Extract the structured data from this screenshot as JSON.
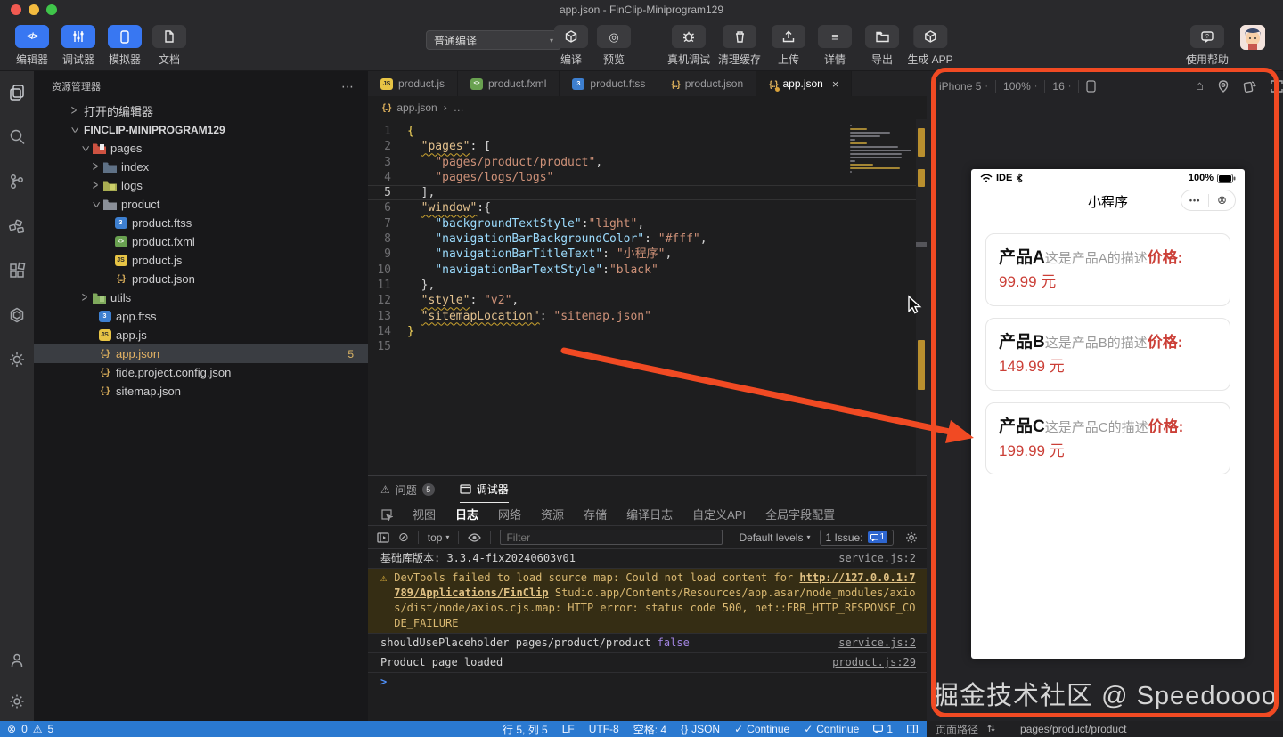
{
  "titlebar": {
    "title": "app.json - FinClip-Miniprogram129"
  },
  "toolbar": {
    "editor": "编辑器",
    "debugger": "调试器",
    "simulator": "模拟器",
    "docs": "文档",
    "compile_mode": "普通编译",
    "compile": "编译",
    "preview": "预览",
    "device_debug": "真机调试",
    "clear_cache": "清理缓存",
    "upload": "上传",
    "details": "详情",
    "export": "导出",
    "gen_app": "生成 APP",
    "help": "使用帮助"
  },
  "explorer": {
    "header": "资源管理器",
    "open_editors": "打开的编辑器",
    "root": "FINCLIP-MINIPROGRAM129",
    "items": {
      "pages": "pages",
      "index": "index",
      "logs": "logs",
      "product": "product",
      "product_ftss": "product.ftss",
      "product_fxml": "product.fxml",
      "product_js": "product.js",
      "product_json": "product.json",
      "utils": "utils",
      "app_ftss": "app.ftss",
      "app_js": "app.js",
      "app_json": "app.json",
      "app_json_badge": "5",
      "fide": "fide.project.config.json",
      "sitemap": "sitemap.json"
    }
  },
  "editor": {
    "tabs": [
      {
        "label": "product.js"
      },
      {
        "label": "product.fxml"
      },
      {
        "label": "product.ftss"
      },
      {
        "label": "product.json"
      },
      {
        "label": "app.json"
      }
    ],
    "breadcrumb": {
      "file": "app.json",
      "more": "…"
    },
    "code_lines": [
      {
        "n": "1",
        "s": [
          [
            "{",
            "b1"
          ]
        ]
      },
      {
        "n": "2",
        "s": [
          [
            "  ",
            "p"
          ],
          [
            "\"pages\"",
            "kw sq"
          ],
          [
            ": [",
            "p"
          ]
        ]
      },
      {
        "n": "3",
        "s": [
          [
            "    ",
            "p"
          ],
          [
            "\"pages/product/product\"",
            "str"
          ],
          [
            ",",
            "p"
          ]
        ]
      },
      {
        "n": "4",
        "s": [
          [
            "    ",
            "p"
          ],
          [
            "\"pages/logs/logs\"",
            "str"
          ]
        ]
      },
      {
        "n": "5",
        "s": [
          [
            "  ],",
            "p"
          ]
        ],
        "cur": true
      },
      {
        "n": "6",
        "s": [
          [
            "  ",
            "p"
          ],
          [
            "\"window\"",
            "kw sq"
          ],
          [
            ":{",
            "p"
          ]
        ]
      },
      {
        "n": "7",
        "s": [
          [
            "    ",
            "p"
          ],
          [
            "\"backgroundTextStyle\"",
            "key"
          ],
          [
            ":",
            "p"
          ],
          [
            "\"light\"",
            "str"
          ],
          [
            ",",
            "p"
          ]
        ]
      },
      {
        "n": "8",
        "s": [
          [
            "    ",
            "p"
          ],
          [
            "\"navigationBarBackgroundColor\"",
            "key"
          ],
          [
            ": ",
            "p"
          ],
          [
            "\"#fff\"",
            "str"
          ],
          [
            ",",
            "p"
          ]
        ]
      },
      {
        "n": "9",
        "s": [
          [
            "    ",
            "p"
          ],
          [
            "\"navigationBarTitleText\"",
            "key"
          ],
          [
            ": ",
            "p"
          ],
          [
            "\"小程序\"",
            "str"
          ],
          [
            ",",
            "p"
          ]
        ]
      },
      {
        "n": "10",
        "s": [
          [
            "    ",
            "p"
          ],
          [
            "\"navigationBarTextStyle\"",
            "key"
          ],
          [
            ":",
            "p"
          ],
          [
            "\"black\"",
            "str"
          ]
        ]
      },
      {
        "n": "11",
        "s": [
          [
            "  },",
            "p"
          ]
        ]
      },
      {
        "n": "12",
        "s": [
          [
            "  ",
            "p"
          ],
          [
            "\"style\"",
            "kw sq"
          ],
          [
            ": ",
            "p"
          ],
          [
            "\"v2\"",
            "str"
          ],
          [
            ",",
            "p"
          ]
        ]
      },
      {
        "n": "13",
        "s": [
          [
            "  ",
            "p"
          ],
          [
            "\"sitemapLocation\"",
            "kw sq"
          ],
          [
            ": ",
            "p"
          ],
          [
            "\"sitemap.json\"",
            "str"
          ]
        ]
      },
      {
        "n": "14",
        "s": [
          [
            "}",
            "b1"
          ]
        ]
      },
      {
        "n": "15",
        "s": []
      }
    ]
  },
  "panel": {
    "problems": "问题",
    "problems_count": "5",
    "debugger_tab": "调试器",
    "devtabs": [
      "视图",
      "日志",
      "网络",
      "资源",
      "存储",
      "编译日志",
      "自定义API",
      "全局字段配置"
    ],
    "top": "top",
    "filter": "Filter",
    "levels": "Default levels",
    "issues": "1 Issue:",
    "issues_count": "1",
    "console": {
      "r1": "基础库版本: 3.3.4-fix20240603v01",
      "r1_link": "service.js:2",
      "warn_pre": "DevTools failed to load source map: Could not load content for ",
      "warn_link": "http://127.0.0.1:7789/Applications/FinClip",
      "warn_rest": " Studio.app/Contents/Resources/app.asar/node_modules/axios/dist/node/axios.cjs.map: HTTP error: status code 500, net::ERR_HTTP_RESPONSE_CODE_FAILURE",
      "r3_pre": "shouldUsePlaceholder pages/product/product ",
      "r3_bool": "false",
      "r3_link": "service.js:2",
      "r4": "Product page loaded",
      "r4_link": "product.js:29"
    }
  },
  "simulator": {
    "device": "iPhone 5",
    "zoom": "100%",
    "fontsize": "16",
    "phone": {
      "carrier": "IDE",
      "battery": "100%",
      "title": "小程序",
      "cards": [
        {
          "name": "产品A",
          "desc": "这是产品A的描述",
          "price_label": "价格:",
          "price": " 99.99 元"
        },
        {
          "name": "产品B",
          "desc": "这是产品B的描述",
          "price_label": "价格:",
          "price": " 149.99 元"
        },
        {
          "name": "产品C",
          "desc": "这是产品C的描述",
          "price_label": "价格:",
          "price": " 199.99 元"
        }
      ]
    },
    "watermark": "掘金技术社区 @ Speedoooo"
  },
  "statusbar": {
    "errors": "0",
    "warnings": "5",
    "line_col": "行 5, 列 5",
    "eol": "LF",
    "encoding": "UTF-8",
    "indent": "空格: 4",
    "lang_icon": "{}",
    "lang": "JSON",
    "continue1": "Continue",
    "continue2": "Continue",
    "notif": "1",
    "path_label": "页面路径",
    "path": "pages/product/product"
  },
  "icons": {
    "more": "⋯",
    "chevron": ">",
    "caret": "▾",
    "crumb_sep": "›",
    "warning": "⚠",
    "error": "⊗",
    "dots": "•••",
    "close": "×",
    "circle_x": "⊗",
    "home": "⌂",
    "preview": "◎",
    "list": "≡",
    "dot": "·",
    "clear": "⊘",
    "json": "{..}",
    "js": "JS",
    "ftss": "3",
    "fxml": "<>",
    "check": "✓",
    "code": "</>"
  },
  "colors": {
    "accent_red": "#f14a23",
    "statusbar_blue": "#2a79d0",
    "price_red": "#cb3f37"
  }
}
